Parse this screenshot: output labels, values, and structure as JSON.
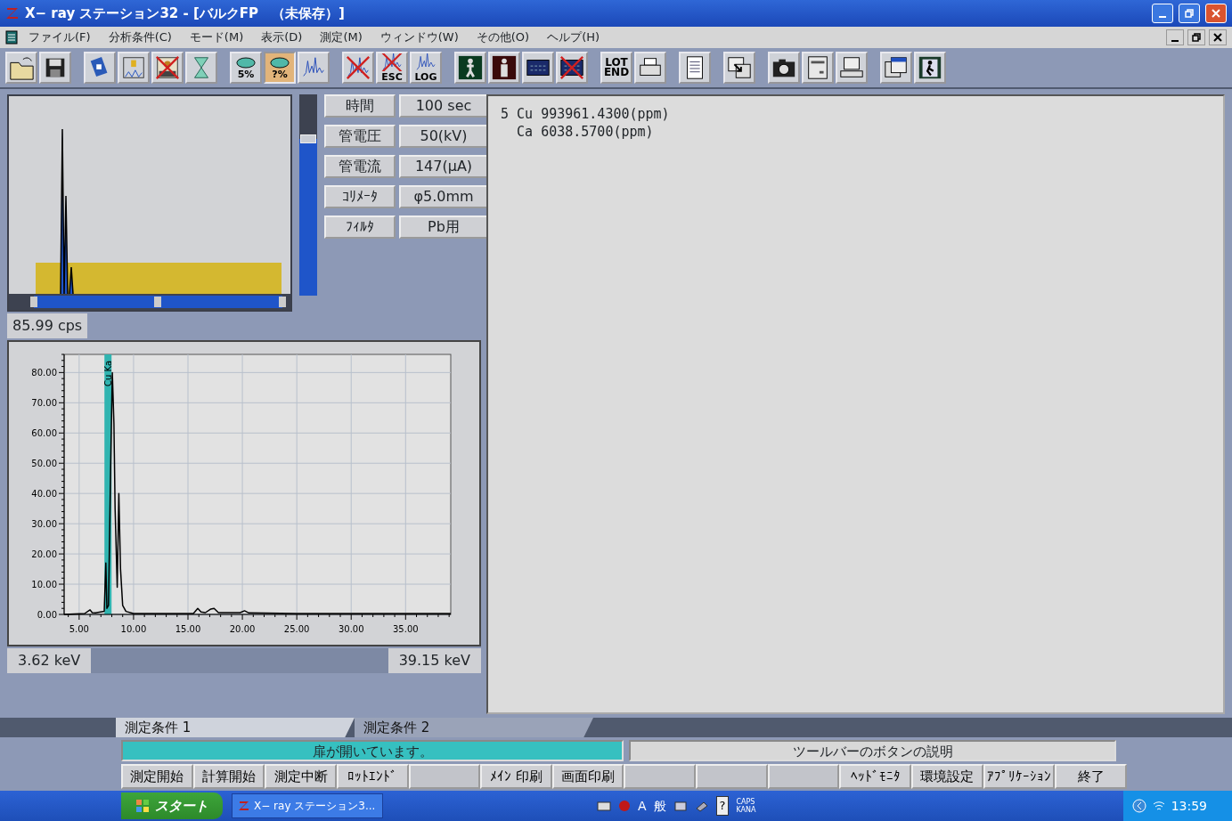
{
  "window": {
    "title": "X− ray ステーション32 - [バルクFP　（未保存）]"
  },
  "menu": [
    "ファイル(F)",
    "分析条件(C)",
    "モード(M)",
    "表示(D)",
    "測定(M)",
    "ウィンドウ(W)",
    "その他(O)",
    "ヘルプ(H)"
  ],
  "toolbar": [
    [
      {
        "kind": "open",
        "crossed": false,
        "selected": false
      },
      {
        "kind": "save",
        "crossed": false,
        "selected": false
      }
    ],
    [
      {
        "kind": "card",
        "crossed": false,
        "selected": false
      },
      {
        "kind": "query",
        "crossed": false,
        "selected": false
      },
      {
        "kind": "picture",
        "crossed": true,
        "selected": false
      },
      {
        "kind": "hourglass",
        "crossed": false,
        "selected": false
      }
    ],
    [
      {
        "kind": "percent",
        "text": "5%",
        "crossed": false,
        "selected": false
      },
      {
        "kind": "percent",
        "text": "?%",
        "crossed": false,
        "selected": true
      },
      {
        "kind": "spectrum",
        "crossed": false,
        "selected": false
      }
    ],
    [
      {
        "kind": "spectrum",
        "crossed": true,
        "selected": false
      },
      {
        "kind": "spectrum",
        "text": "ESC",
        "crossed": true,
        "selected": false
      },
      {
        "kind": "spectrum",
        "text": "LOG",
        "crossed": false,
        "selected": false
      }
    ],
    [
      {
        "kind": "walker",
        "crossed": false,
        "selected": false
      },
      {
        "kind": "person",
        "crossed": false,
        "selected": false
      },
      {
        "kind": "calculator",
        "crossed": false,
        "selected": false
      },
      {
        "kind": "calculator",
        "crossed": true,
        "selected": false
      }
    ],
    [
      {
        "kind": "label",
        "text": "LOT END",
        "crossed": false,
        "selected": false
      },
      {
        "kind": "printer",
        "crossed": false,
        "selected": false
      }
    ],
    [
      {
        "kind": "document",
        "crossed": false,
        "selected": false
      }
    ],
    [
      {
        "kind": "window-arrow",
        "crossed": false,
        "selected": false
      }
    ],
    [
      {
        "kind": "camera",
        "crossed": false,
        "selected": false
      },
      {
        "kind": "device",
        "crossed": false,
        "selected": false
      },
      {
        "kind": "computer",
        "crossed": false,
        "selected": false
      }
    ],
    [
      {
        "kind": "windows",
        "crossed": false,
        "selected": false
      },
      {
        "kind": "exit",
        "crossed": false,
        "selected": false
      }
    ]
  ],
  "preview": {
    "scale_slider": {
      "level": 0.78
    },
    "range_slider": {
      "start": {
        "level": 0.09
      },
      "middle": {
        "level": 0.53
      },
      "end": {
        "level": 0.97
      }
    }
  },
  "conditions": [
    {
      "label": "時間",
      "value": "100 sec"
    },
    {
      "label": "管電圧",
      "value": "50(kV)"
    },
    {
      "label": "管電流",
      "value": "147(μA)"
    },
    {
      "label": "ｺﾘﾒｰﾀ",
      "value": "φ5.0mm"
    },
    {
      "label": "ﾌｨﾙﾀ",
      "value": "Pb用"
    }
  ],
  "count_rate": "85.99 cps",
  "spectrum": {
    "chart_data": {
      "type": "line",
      "x": [
        3.62,
        5.5,
        6.0,
        6.2,
        6.5,
        7.3,
        7.45,
        7.55,
        7.7,
        7.9,
        8.05,
        8.2,
        8.3,
        8.5,
        8.65,
        8.8,
        9.0,
        9.3,
        10.0,
        15.5,
        15.9,
        16.2,
        16.6,
        17.1,
        17.4,
        17.8,
        19.8,
        20.2,
        20.6,
        25.0,
        30.0,
        35.0,
        39.15
      ],
      "values": [
        0,
        0.3,
        1.5,
        0.6,
        0.5,
        1,
        17,
        2,
        3,
        50,
        80,
        63,
        35,
        9,
        40,
        15,
        3,
        1,
        0.3,
        0.3,
        2,
        0.8,
        0.6,
        1.8,
        2,
        0.6,
        0.6,
        1.2,
        0.5,
        0.3,
        0.3,
        0.3,
        0.3
      ],
      "xticks": [
        {
          "value": 5,
          "label": "5.00"
        },
        {
          "value": 10,
          "label": "10.00"
        },
        {
          "value": 15,
          "label": "15.00"
        },
        {
          "value": 20,
          "label": "20.00"
        },
        {
          "value": 25,
          "label": "25.00"
        },
        {
          "value": 30,
          "label": "30.00"
        },
        {
          "value": 35,
          "label": "35.00"
        }
      ],
      "yticks": [
        {
          "value": 0,
          "label": "0.00"
        },
        {
          "value": 10,
          "label": "10.00"
        },
        {
          "value": 20,
          "label": "20.00"
        },
        {
          "value": 30,
          "label": "30.00"
        },
        {
          "value": 40,
          "label": "40.00"
        },
        {
          "value": 50,
          "label": "50.00"
        },
        {
          "value": 60,
          "label": "60.00"
        },
        {
          "value": 70,
          "label": "70.00"
        },
        {
          "value": 80,
          "label": "80.00"
        }
      ],
      "xlim": [
        3.62,
        39.15
      ],
      "ylim": [
        0,
        86
      ],
      "grid": true,
      "ref_lines": [
        {
          "axis": "x",
          "value": 7.65,
          "label": "Cu Ka",
          "color": "#30b4b0"
        }
      ]
    },
    "range_start": "3.62 keV",
    "range_end": "39.15 keV"
  },
  "results": [
    {
      "index": "5",
      "element": "Cu",
      "value": "993961.4300(ppm)"
    },
    {
      "element": "Ca",
      "value": "6038.5700(ppm)"
    }
  ],
  "tabs": [
    {
      "label": "測定条件 1",
      "selected": true
    },
    {
      "label": "測定条件 2",
      "selected": false
    }
  ],
  "status": {
    "message": "扉が開いています。",
    "hint": "ツールバーのボタンの説明"
  },
  "function_keys": [
    {
      "kind": "key",
      "label": "測定開始"
    },
    {
      "kind": "key",
      "label": "計算開始"
    },
    {
      "kind": "key",
      "label": "測定中断"
    },
    {
      "kind": "key",
      "label": "ﾛｯﾄｴﾝﾄﾞ"
    },
    {
      "kind": "blank"
    },
    {
      "kind": "key",
      "label": "ﾒｲﾝ 印刷"
    },
    {
      "kind": "key",
      "label": "画面印刷"
    },
    {
      "kind": "blank"
    },
    {
      "kind": "blank"
    },
    {
      "kind": "blank"
    },
    {
      "kind": "key",
      "label": "ﾍｯﾄﾞﾓﾆﾀ"
    },
    {
      "kind": "key",
      "label": "環境設定"
    },
    {
      "kind": "key",
      "label": "ｱﾌﾟﾘｹｰｼｮﾝ"
    },
    {
      "kind": "key",
      "label": "終了"
    }
  ],
  "taskbar": {
    "start": "スタート",
    "task": "X− ray ステーション3...",
    "ime_mode": "A",
    "ime_kanji": "般",
    "help": "?",
    "caps": "CAPS",
    "kana": "KANA",
    "clock": "13:59"
  }
}
